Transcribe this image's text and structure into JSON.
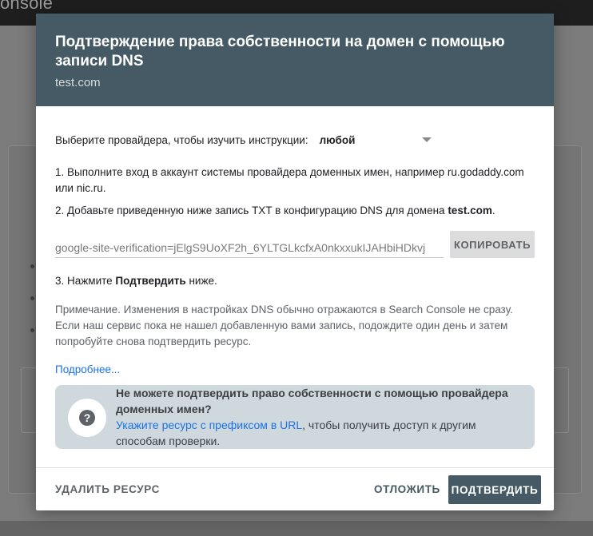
{
  "background": {
    "logo_fragment": "onsole"
  },
  "dialog": {
    "title": "Подтверждение права собственности на домен с помощью записи DNS",
    "subtitle": "test.com",
    "provider": {
      "label": "Выберите провайдера, чтобы изучить инструкции:",
      "selected": "любой"
    },
    "steps": {
      "step1": "1. Выполните вход в аккаунт системы провайдера доменных имен, например ru.godaddy.com или nic.ru.",
      "step2_prefix": "2. Добавьте приведенную ниже запись TXT в конфигурацию DNS для домена ",
      "step2_domain": "test.com",
      "step2_suffix": ".",
      "step3_prefix": "3. Нажмите ",
      "step3_bold": "Подтвердить",
      "step3_suffix": " ниже."
    },
    "verification": {
      "value": "google-site-verification=jElgS9UoXF2h_6YLTGLkcfxA0nkxxukIJAHbiHDkvj",
      "copy_label": "КОПИРОВАТЬ"
    },
    "note": "Примечание. Изменения в настройках DNS обычно отражаются в Search Console не сразу. Если наш сервис пока не нашел добавленную вами запись, подождите один день и затем попробуйте снова подтвердить ресурс.",
    "more_link": "Подробнее...",
    "info": {
      "title": "Не можете подтвердить право собственности с помощью провайдера доменных имен?",
      "link": "Укажите ресурс с префиксом в URL",
      "text": ", чтобы получить доступ к другим способам проверки."
    },
    "footer": {
      "delete_label": "УДАЛИТЬ РЕСУРС",
      "later_label": "ОТЛОЖИТЬ",
      "confirm_label": "ПОДТВЕРДИТЬ"
    }
  },
  "icons": {
    "info": "help-circle-icon",
    "dropdown": "caret-down-icon"
  }
}
